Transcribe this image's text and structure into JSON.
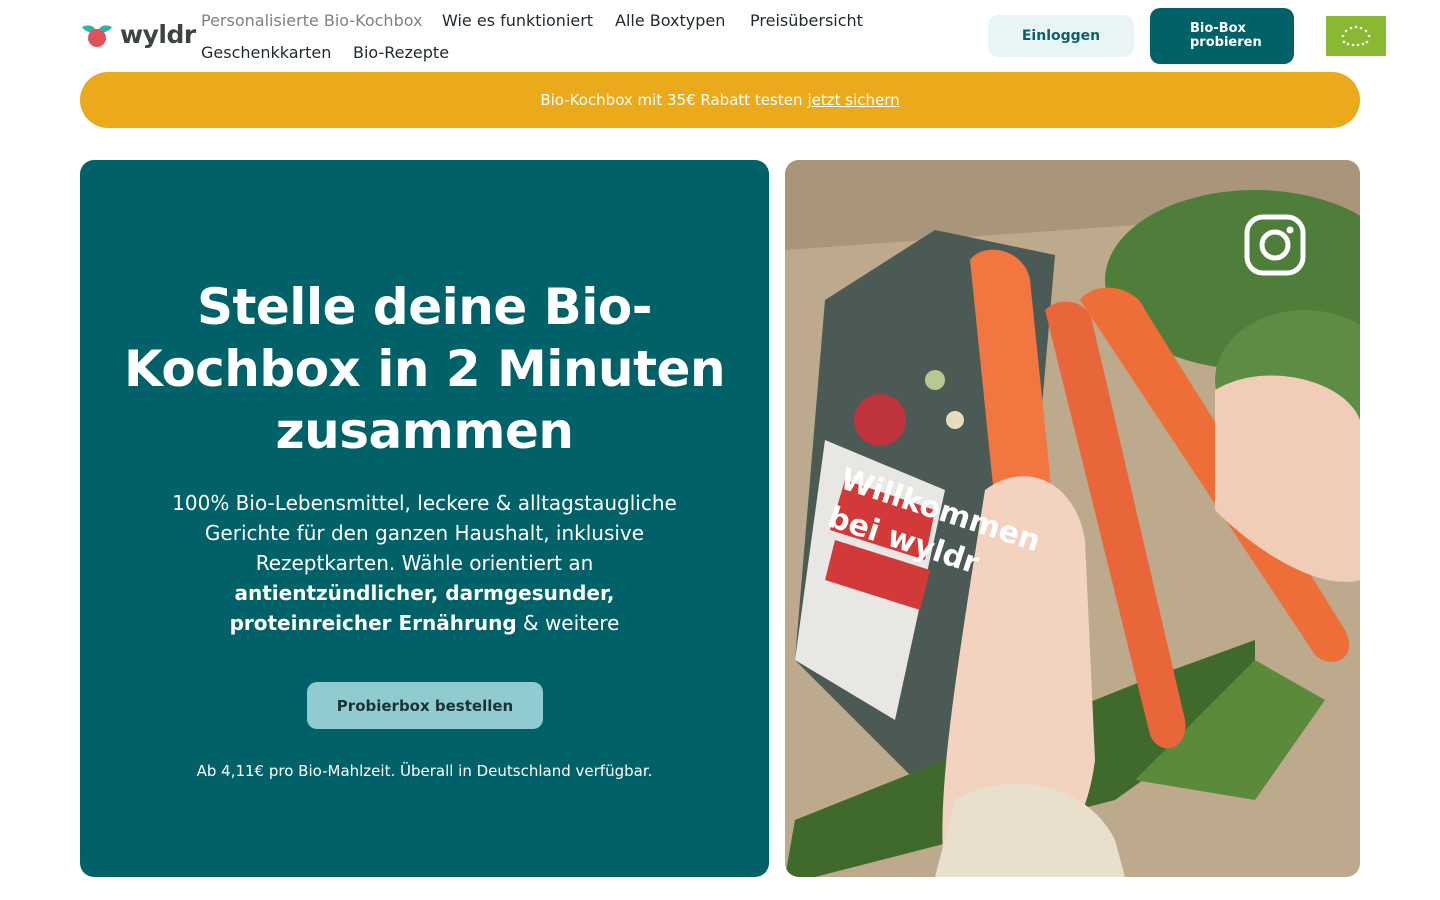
{
  "brand": {
    "name": "wyldr"
  },
  "nav": {
    "items": [
      {
        "label": "Personalisierte Bio-Kochbox"
      },
      {
        "label": "Wie es funktioniert"
      },
      {
        "label": "Alle Boxtypen"
      },
      {
        "label": "Preisübersicht"
      },
      {
        "label": "Geschenkkarten"
      },
      {
        "label": "Bio-Rezepte"
      }
    ]
  },
  "header": {
    "login_label": "Einloggen",
    "try_label_line1": "Bio-Box",
    "try_label_line2": "probieren"
  },
  "promo": {
    "text": "Bio-Kochbox mit 35€ Rabatt testen",
    "link": "jetzt sichern"
  },
  "hero": {
    "title": "Stelle deine Bio-Kochbox in 2 Minuten zusammen",
    "sub_part1": "100% Bio-Lebensmittel, leckere & alltagstaugliche Gerichte für den ganzen Haushalt, inklusive Rezeptkarten. Wähle orientiert an ",
    "sub_bold": "antientzündlicher, darmgesunder, proteinreicher Ernährung",
    "sub_part2": " & weitere",
    "cta_label": "Probierbox bestellen",
    "price_note": "Ab 4,11€ pro Bio-Mahlzeit. Überall in Deutschland verfügbar."
  },
  "media": {
    "card_text_line1": "Willkommen",
    "card_text_line2": "bei wyldr",
    "icons": [
      "instagram-icon"
    ]
  },
  "colors": {
    "primary": "#006169",
    "promo": "#ebaa1b",
    "cta": "#8fcbcf",
    "login_bg": "#e9f5f5",
    "eu_green": "#8ab833"
  }
}
